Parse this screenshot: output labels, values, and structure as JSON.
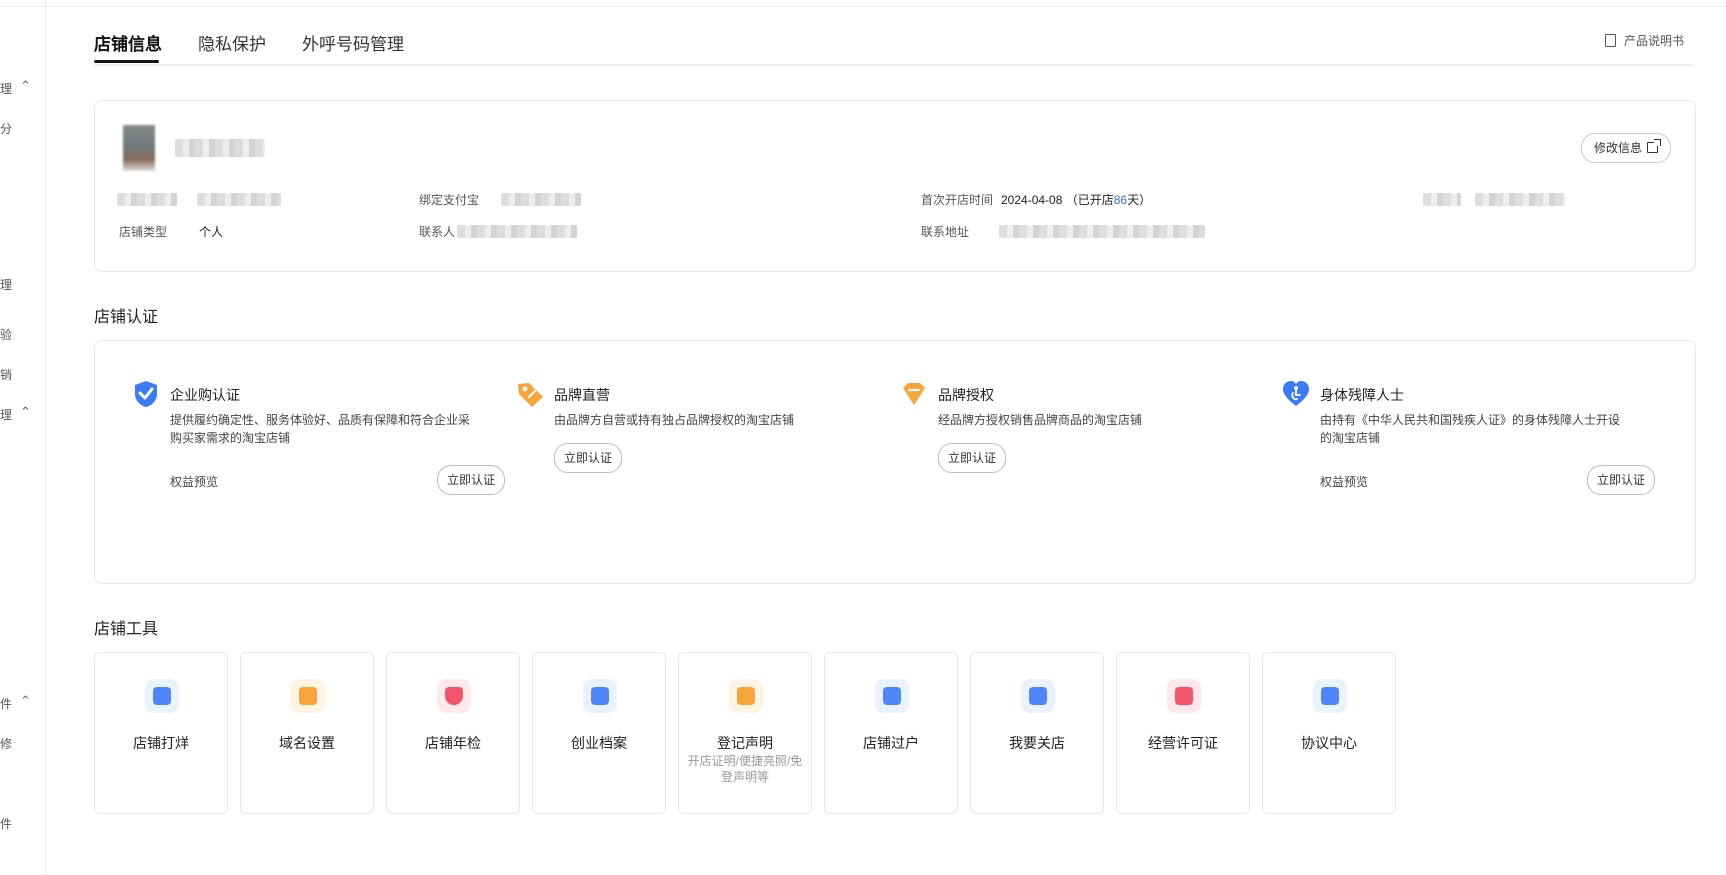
{
  "sidebar": {
    "fragments": [
      "理",
      "分",
      "理",
      "验",
      "销",
      "理",
      "件",
      "修",
      "件"
    ]
  },
  "tabs": [
    {
      "label": "店铺信息",
      "active": true
    },
    {
      "label": "隐私保护",
      "active": false
    },
    {
      "label": "外呼号码管理",
      "active": false
    }
  ],
  "header": {
    "manual_label": "产品说明书"
  },
  "shop_info": {
    "edit_label": "修改信息",
    "bind_alipay_label": "绑定支付宝",
    "contact_label": "联系人",
    "shop_type_label": "店铺类型",
    "shop_type_value": "个人",
    "first_open_label": "首次开店时间",
    "first_open_date": "2024-04-08",
    "open_prefix": "（已开店",
    "open_days": "86",
    "open_suffix": "天）",
    "address_label": "联系地址"
  },
  "cert_section": {
    "title": "店铺认证",
    "items": [
      {
        "name": "企业购认证",
        "desc": "提供履约确定性、服务体验好、品质有保障和符合企业采购买家需求的淘宝店铺",
        "preview": "权益预览",
        "button": "立即认证",
        "icon": "shield-check-icon",
        "color": "#3b7bf6"
      },
      {
        "name": "品牌直营",
        "desc": "由品牌方自营或持有独占品牌授权的淘宝店铺",
        "preview": "",
        "button": "立即认证",
        "icon": "tag-icon",
        "color": "#f7a43a"
      },
      {
        "name": "品牌授权",
        "desc": "经品牌方授权销售品牌商品的淘宝店铺",
        "preview": "",
        "button": "立即认证",
        "icon": "diamond-icon",
        "color": "#f7a43a"
      },
      {
        "name": "身体残障人士",
        "desc": "由持有《中华人民共和国残疾人证》的身体残障人士开设的淘宝店铺",
        "preview": "权益预览",
        "button": "立即认证",
        "icon": "accessibility-heart-icon",
        "color": "#3b7bf6"
      }
    ]
  },
  "tools_section": {
    "title": "店铺工具",
    "items": [
      {
        "label": "店铺打烊",
        "sub": "",
        "icon": "store-close-icon",
        "color": "#4f86f7"
      },
      {
        "label": "域名设置",
        "sub": "",
        "icon": "domain-icon",
        "color": "#f7a43a"
      },
      {
        "label": "店铺年检",
        "sub": "",
        "icon": "shield-search-icon",
        "color": "#f2556b"
      },
      {
        "label": "创业档案",
        "sub": "",
        "icon": "archive-icon",
        "color": "#4f86f7"
      },
      {
        "label": "登记声明",
        "sub": "开店证明/便捷亮照/免登声明等",
        "icon": "declaration-icon",
        "color": "#f7a43a"
      },
      {
        "label": "店铺过户",
        "sub": "",
        "icon": "transfer-icon",
        "color": "#4f86f7"
      },
      {
        "label": "我要关店",
        "sub": "",
        "icon": "close-shop-icon",
        "color": "#4f86f7"
      },
      {
        "label": "经营许可证",
        "sub": "",
        "icon": "license-folder-icon",
        "color": "#f2556b"
      },
      {
        "label": "协议中心",
        "sub": "",
        "icon": "agreement-icon",
        "color": "#4f86f7"
      }
    ]
  }
}
